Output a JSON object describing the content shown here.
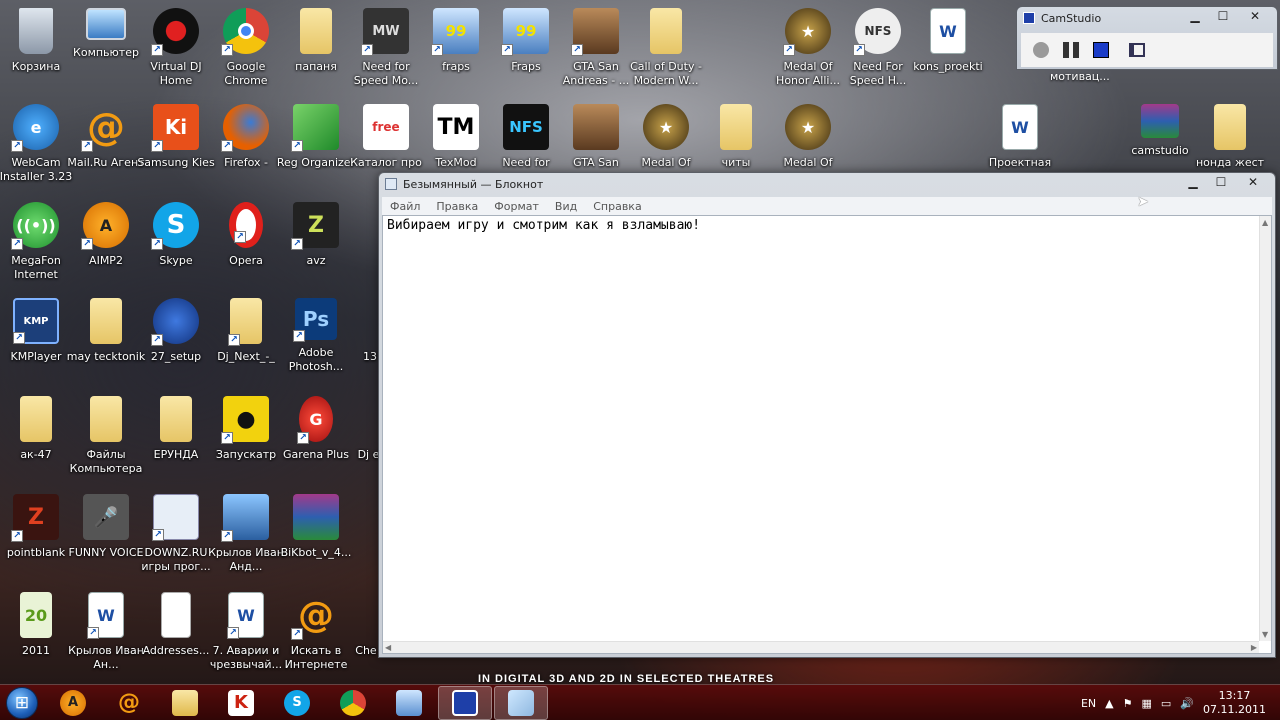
{
  "desktop": {
    "icons": [
      {
        "label": "Корзина",
        "icon": "trash-icon"
      },
      {
        "label": "Компьютер",
        "icon": "computer-icon"
      },
      {
        "label": "Virtual DJ Home",
        "icon": "virtual-dj-icon"
      },
      {
        "label": "Google Chrome",
        "icon": "chrome-icon"
      },
      {
        "label": "папаня",
        "icon": "folder-icon"
      },
      {
        "label": "Need for Speed Mo...",
        "icon": "nfs-mw-icon"
      },
      {
        "label": "fraps",
        "icon": "fraps-icon"
      },
      {
        "label": "Fraps",
        "icon": "fraps-icon"
      },
      {
        "label": "GTA San Andreas - ...",
        "icon": "gta-icon"
      },
      {
        "label": "Call of Duty - Modern W...",
        "icon": "folder-icon"
      },
      {
        "label": "Medal Of Honor Alli...",
        "icon": "medal-of-honor-icon"
      },
      {
        "label": "Need For Speed H...",
        "icon": "nfs-icon"
      },
      {
        "label": "kons_proekti",
        "icon": "word-doc-icon"
      },
      {
        "label": "WebCam Installer 3.23",
        "icon": "webcam-icon"
      },
      {
        "label": "Mail.Ru Агент",
        "icon": "mailru-icon"
      },
      {
        "label": "Samsung Kies",
        "icon": "samsung-kies-icon"
      },
      {
        "label": "Firefox -",
        "icon": "firefox-icon"
      },
      {
        "label": "Reg Organizer",
        "icon": "reg-organizer-icon"
      },
      {
        "label": "Каталог про",
        "icon": "freesoft-icon"
      },
      {
        "label": "TexMod",
        "icon": "texmod-icon"
      },
      {
        "label": "Need for",
        "icon": "nfs-icon"
      },
      {
        "label": "GTA San",
        "icon": "gta-icon"
      },
      {
        "label": "Medal Of",
        "icon": "medal-of-honor-icon"
      },
      {
        "label": "читы",
        "icon": "folder-icon"
      },
      {
        "label": "Medal Of",
        "icon": "medal-of-honor-icon"
      },
      {
        "label": "Проектная",
        "icon": "word-doc-icon"
      },
      {
        "label": "camstudio",
        "icon": "winrar-icon"
      },
      {
        "label": "нонда жест",
        "icon": "folder-icon"
      },
      {
        "label": "MegaFon Internet",
        "icon": "megafon-icon"
      },
      {
        "label": "AIMP2",
        "icon": "aimp-icon"
      },
      {
        "label": "Skype",
        "icon": "skype-icon"
      },
      {
        "label": "Opera",
        "icon": "opera-icon"
      },
      {
        "label": "avz",
        "icon": "avz-icon"
      },
      {
        "label": "KMPlayer",
        "icon": "kmplayer-icon"
      },
      {
        "label": "may tecktonik",
        "icon": "folder-icon"
      },
      {
        "label": "27_setup",
        "icon": "setup-icon"
      },
      {
        "label": "Dj_Next_-_",
        "icon": "folder-icon"
      },
      {
        "label": "Adobe Photosh...",
        "icon": "photoshop-icon"
      },
      {
        "label": "13",
        "icon": "folder-icon"
      },
      {
        "label": "ак-47",
        "icon": "folder-icon"
      },
      {
        "label": "Файлы Компьютера",
        "icon": "folder-icon"
      },
      {
        "label": "ЕРУНДА",
        "icon": "folder-icon"
      },
      {
        "label": "Запускатр",
        "icon": "launcher-icon"
      },
      {
        "label": "Garena Plus",
        "icon": "garena-icon"
      },
      {
        "label": "Dj el",
        "icon": "folder-icon"
      },
      {
        "label": "pointblank",
        "icon": "pointblank-icon"
      },
      {
        "label": "FUNNY VOICE",
        "icon": "funny-voice-icon"
      },
      {
        "label": "DOWNZ.RU игры прог...",
        "icon": "downz-icon"
      },
      {
        "label": "Крылов Иван Анд...",
        "icon": "image-icon"
      },
      {
        "label": "BiKbot_v_4...",
        "icon": "winrar-icon"
      },
      {
        "label": "2011",
        "icon": "folder-icon"
      },
      {
        "label": "Крылов Иван Ан...",
        "icon": "word-doc-icon"
      },
      {
        "label": "Addresses...",
        "icon": "blank-doc-icon"
      },
      {
        "label": "7. Аварии и чрезвычай...",
        "icon": "word-doc-icon"
      },
      {
        "label": "Искать в Интернете",
        "icon": "mailru-search-icon"
      },
      {
        "label": "Che",
        "icon": "folder-icon"
      }
    ],
    "extra_label": "мотивац...",
    "background_banner": "IN DIGITAL 3D AND 2D IN SELECTED THEATRES"
  },
  "notepad": {
    "title": "Безымянный — Блокнот",
    "menu": [
      "Файл",
      "Правка",
      "Формат",
      "Вид",
      "Справка"
    ],
    "content": "Вибираем игру и смотрим как я взламываю!"
  },
  "camstudio": {
    "title": "CamStudio"
  },
  "taskbar": {
    "tasks": [
      "aimp-icon",
      "mailru-icon",
      "explorer-icon",
      "kaspersky-icon",
      "skype-icon",
      "chrome-icon",
      "control-panel-icon",
      "camstudio-icon",
      "notepad-icon"
    ],
    "language": "EN",
    "time": "13:17",
    "date": "07.11.2011"
  }
}
